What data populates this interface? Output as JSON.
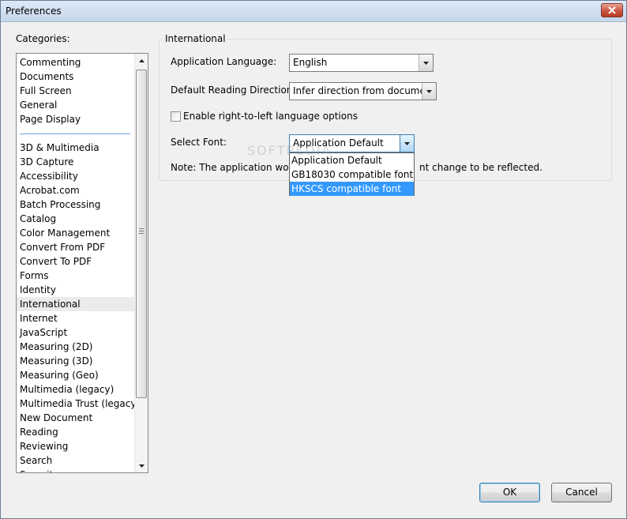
{
  "window": {
    "title": "Preferences"
  },
  "categories": {
    "label": "Categories:",
    "group1": [
      "Commenting",
      "Documents",
      "Full Screen",
      "General",
      "Page Display"
    ],
    "group2": [
      "3D & Multimedia",
      "3D Capture",
      "Accessibility",
      "Acrobat.com",
      "Batch Processing",
      "Catalog",
      "Color Management",
      "Convert From PDF",
      "Convert To PDF",
      "Forms",
      "Identity",
      "International",
      "Internet",
      "JavaScript",
      "Measuring (2D)",
      "Measuring (3D)",
      "Measuring (Geo)",
      "Multimedia (legacy)",
      "Multimedia Trust (legacy)",
      "New Document",
      "Reading",
      "Reviewing",
      "Search",
      "Security"
    ],
    "selected": "International"
  },
  "panel": {
    "group_title": "International",
    "app_language_label": "Application Language:",
    "app_language_value": "English",
    "reading_direction_label": "Default Reading Direction:",
    "reading_direction_value": "Infer direction from document",
    "rtl_checkbox_label": "Enable right-to-left language options",
    "rtl_checked": false,
    "select_font_label": "Select Font:",
    "select_font_value": "Application Default",
    "note_start": "Note: The application would",
    "note_end": "nt change to be reflected.",
    "font_options": [
      "Application Default",
      "GB18030 compatible font",
      "HKSCS compatible font"
    ],
    "font_highlighted": "HKSCS compatible font"
  },
  "watermark": "SOFTPEDIA",
  "buttons": {
    "ok": "OK",
    "cancel": "Cancel"
  }
}
